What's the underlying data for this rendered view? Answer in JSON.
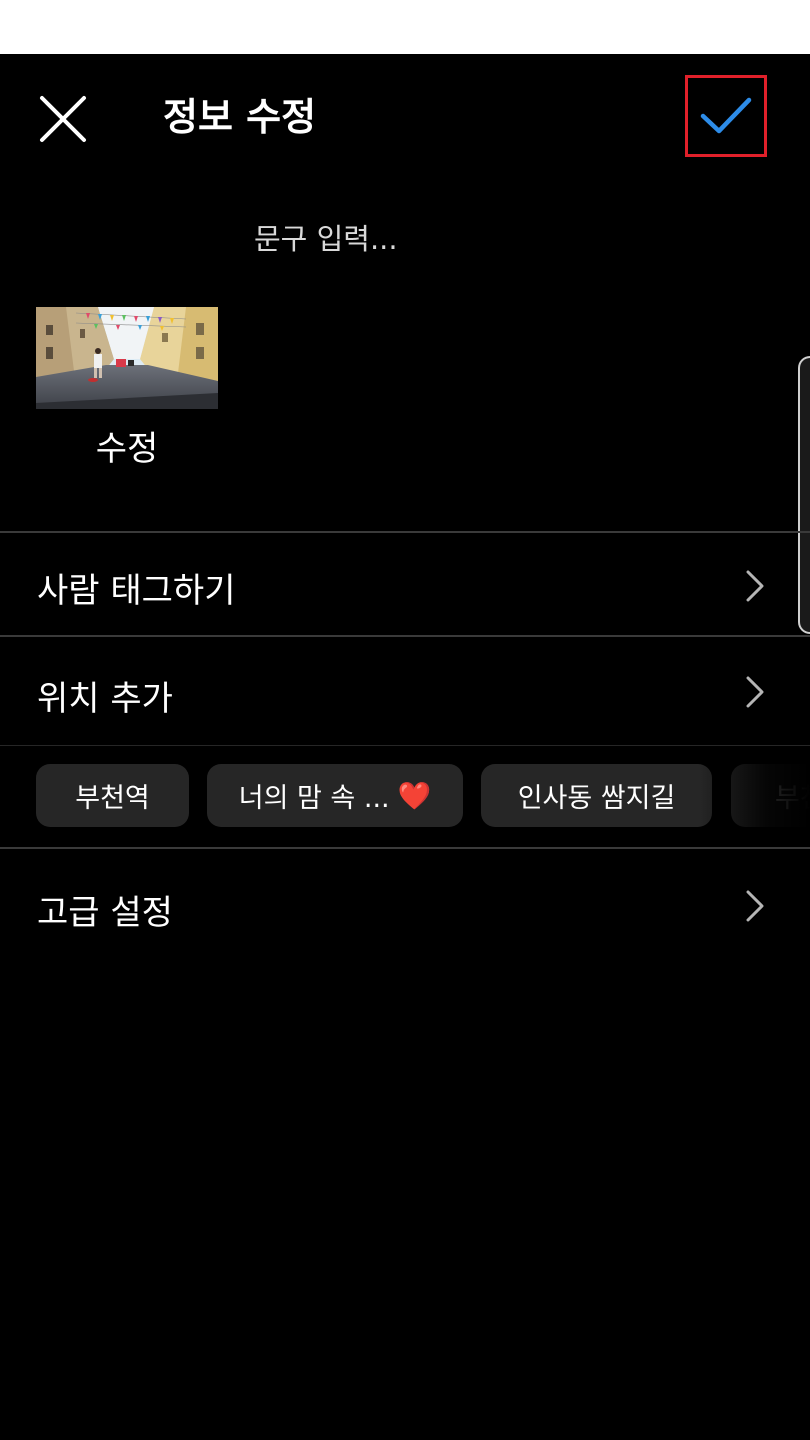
{
  "header": {
    "title": "정보 수정",
    "close_icon": "close-icon",
    "confirm_icon": "checkmark-icon",
    "confirm_color": "#2d8ce8",
    "highlight_color": "#e0202a"
  },
  "caption": {
    "placeholder": "문구 입력...",
    "value": ""
  },
  "media": {
    "edit_label": "수정"
  },
  "menu": {
    "tag_people": "사람 태그하기",
    "add_location": "위치 추가",
    "advanced_settings": "고급 설정"
  },
  "location_chips": [
    {
      "label": "부천역"
    },
    {
      "label": "너의 맘 속 ...",
      "emoji": "❤️"
    },
    {
      "label": "인사동 쌈지길"
    },
    {
      "label": "부천"
    }
  ]
}
